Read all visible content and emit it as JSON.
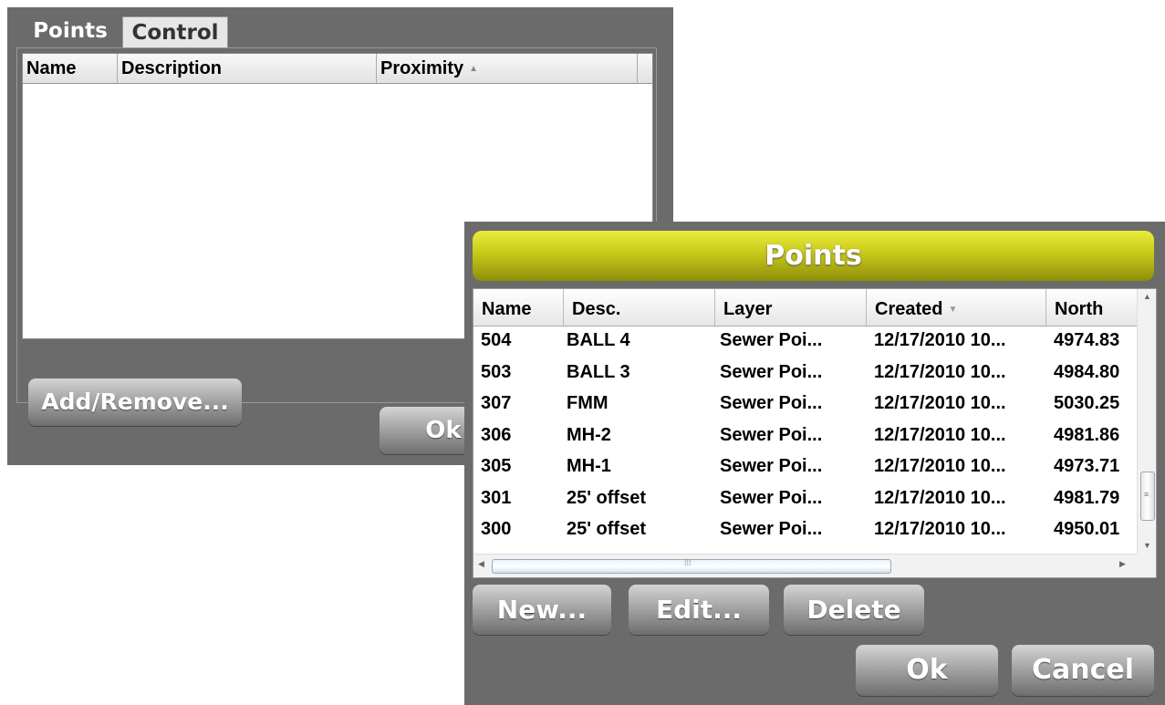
{
  "back_window": {
    "tabs": [
      {
        "label": "Points",
        "active": true
      },
      {
        "label": "Control",
        "active": false
      }
    ],
    "columns": [
      "Name",
      "Description",
      "Proximity"
    ],
    "sort_column": "Proximity",
    "sort_direction": "ascending",
    "add_remove_label": "Add/Remove...",
    "ok_label": "Ok"
  },
  "dialog": {
    "title": "Points",
    "columns": [
      "Name",
      "Desc.",
      "Layer",
      "Created",
      "North"
    ],
    "sort_column": "Created",
    "sort_direction": "descending",
    "rows": [
      {
        "name": "504",
        "desc": "BALL 4",
        "layer": "Sewer Poi...",
        "created": "12/17/2010 10...",
        "north": "4974.83"
      },
      {
        "name": "503",
        "desc": "BALL 3",
        "layer": "Sewer Poi...",
        "created": "12/17/2010 10...",
        "north": "4984.80"
      },
      {
        "name": "307",
        "desc": "FMM",
        "layer": "Sewer Poi...",
        "created": "12/17/2010 10...",
        "north": "5030.25"
      },
      {
        "name": "306",
        "desc": "MH-2",
        "layer": "Sewer Poi...",
        "created": "12/17/2010 10...",
        "north": "4981.86"
      },
      {
        "name": "305",
        "desc": "MH-1",
        "layer": "Sewer Poi...",
        "created": "12/17/2010 10...",
        "north": "4973.71"
      },
      {
        "name": "301",
        "desc": "25' offset",
        "layer": "Sewer Poi...",
        "created": "12/17/2010 10...",
        "north": "4981.79"
      },
      {
        "name": "300",
        "desc": "25' offset",
        "layer": "Sewer Poi...",
        "created": "12/17/2010 10...",
        "north": "4950.01"
      }
    ],
    "buttons": {
      "new": "New...",
      "edit": "Edit...",
      "delete": "Delete",
      "ok": "Ok",
      "cancel": "Cancel"
    }
  },
  "colors": {
    "window_bg": "#6b6b6b",
    "title_accent": "#c8c81a",
    "button_text": "#ffffff"
  }
}
